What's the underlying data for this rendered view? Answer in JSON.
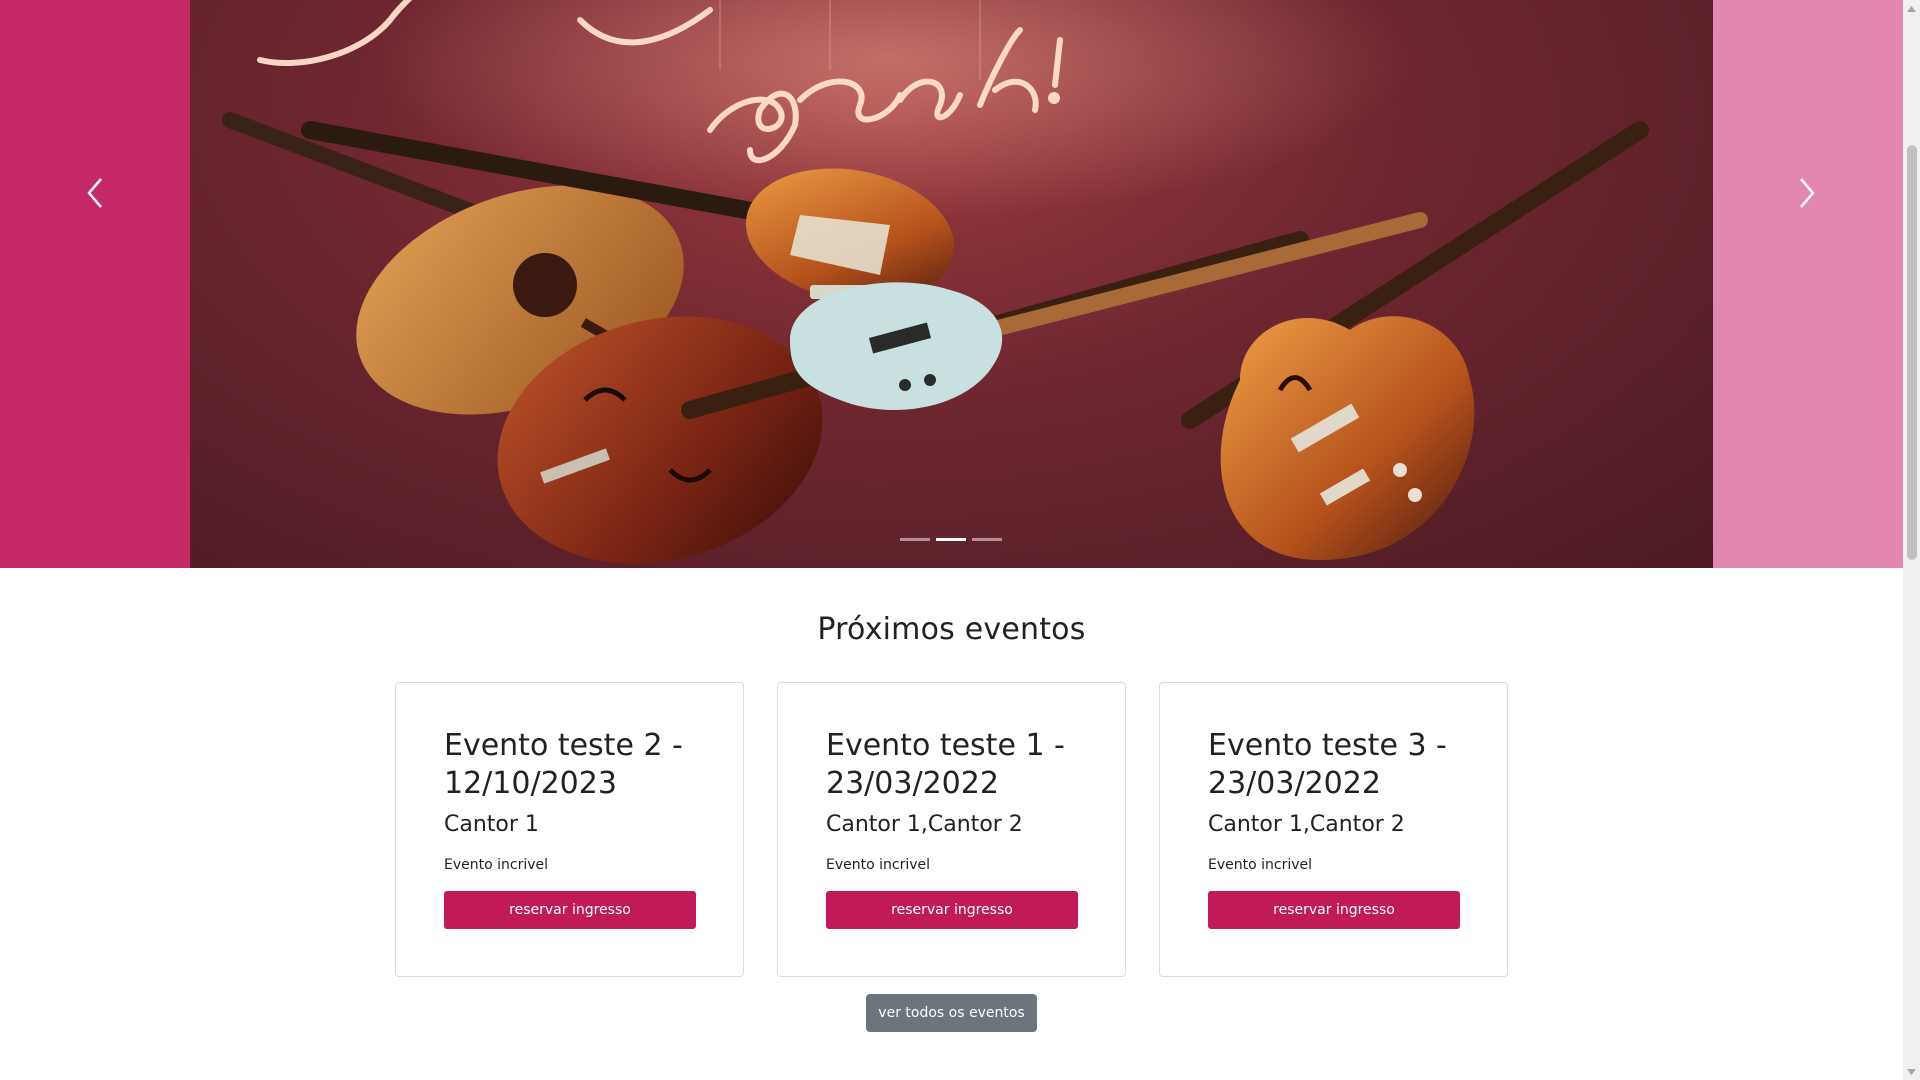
{
  "carousel": {
    "neon_text": "yeah!",
    "slide_count": 3,
    "active_index": 1,
    "prev_icon": "chevron-left-icon",
    "next_icon": "chevron-right-icon",
    "left_band_color": "#c62a66",
    "right_band_color": "#e288ae"
  },
  "events": {
    "title": "Próximos eventos",
    "items": [
      {
        "title": "Evento teste 2 - 12/10/2023",
        "artists": "Cantor 1",
        "description": "Evento incrivel",
        "button": "reservar ingresso"
      },
      {
        "title": "Evento teste 1 - 23/03/2022",
        "artists": "Cantor 1,Cantor 2",
        "description": "Evento incrivel",
        "button": "reservar ingresso"
      },
      {
        "title": "Evento teste 3 - 23/03/2022",
        "artists": "Cantor 1,Cantor 2",
        "description": "Evento incrivel",
        "button": "reservar ingresso"
      }
    ],
    "view_all": "ver todos os eventos"
  },
  "colors": {
    "accent": "#c11a59",
    "secondary_button": "#6c757d"
  }
}
